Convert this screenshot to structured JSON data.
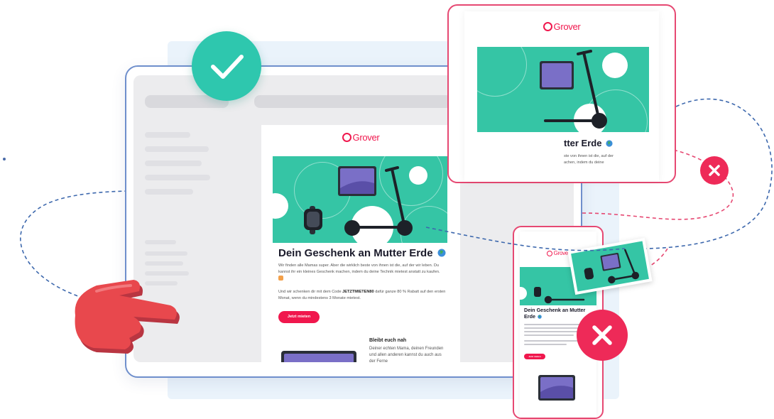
{
  "colors": {
    "brand_pink": "#f0174d",
    "mint": "#35c5a5",
    "check_teal": "#2ec7ae",
    "error_red": "#ee2a58",
    "window_border": "#6f8fcc",
    "dash_blue": "#3d68ad",
    "dash_pink": "#e64872",
    "hand_red": "#e8484d"
  },
  "icons": {
    "check": "check-icon",
    "error": "close-icon",
    "hand": "pointing-hand-icon",
    "globe": "globe-icon"
  },
  "brand": {
    "name": "Grover"
  },
  "email": {
    "title": "Dein Geschenk an Mutter Erde",
    "paragraph_1": "Wir finden alle Mamas super. Aber die wirklich beste von ihnen ist die, auf der wir leben. Du kannst ihr ein kleines Geschenk machen, indem du deine Technik mietest anstatt zu kaufen.",
    "paragraph_2_before": "Und wir schenken dir mit dem Code",
    "code": "JETZTMIETEN80",
    "paragraph_2_after": "dafür ganze 80 % Rabatt auf den ersten Monat, wenn du mindestens 3 Monate mietest.",
    "cta": "Jetzt mieten",
    "sub_title": "Bleibt euch nah",
    "sub_body": "Deiner echten Mama, deinen Freunden und allen anderen kannst du auch aus der Ferne"
  },
  "card_email": {
    "title_fragment": "tter Erde",
    "line_1": "ste von ihnen ist die, auf der",
    "line_2": "achen, indem du deine"
  },
  "phone_email": {
    "title": "Dein Geschenk an Mutter Erde",
    "cta": "Jetzt mieten"
  }
}
